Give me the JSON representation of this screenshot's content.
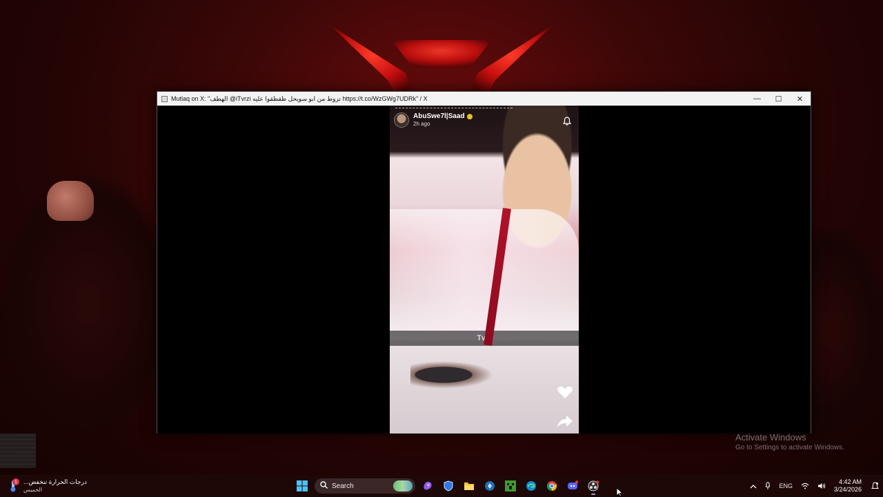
{
  "window": {
    "title": "Mutlaq on X: \"الهطف @iTvrzi تزوط من ابو سويحل ظقظقوا عليه https://t.co/WzGWg7UDRk\" / X",
    "controls": {
      "minimize": "—",
      "maximize": "☐",
      "close": "✕"
    }
  },
  "story": {
    "username": "AbuSwe7l|Saad",
    "time": "2h ago",
    "caption": "Tvrz"
  },
  "watermark": {
    "title": "Activate Windows",
    "subtitle": "Go to Settings to activate Windows."
  },
  "taskbar": {
    "weather": {
      "line1": "درجات الحرارة تنخفض...",
      "line2": "الخميس",
      "badge": "1"
    },
    "search_placeholder": "Search",
    "apps": [
      "windows-start",
      "copilot",
      "shield",
      "file-explorer",
      "widgets",
      "minecraft",
      "edge",
      "chrome",
      "discord",
      "obs"
    ],
    "tray": {
      "language": "ENG",
      "time": "4:42 AM",
      "date": "3/24/2026"
    }
  },
  "colors": {
    "wallpaper": "#3a0707",
    "accent_red": "#d11a1a",
    "taskbar": "#1e0808"
  }
}
